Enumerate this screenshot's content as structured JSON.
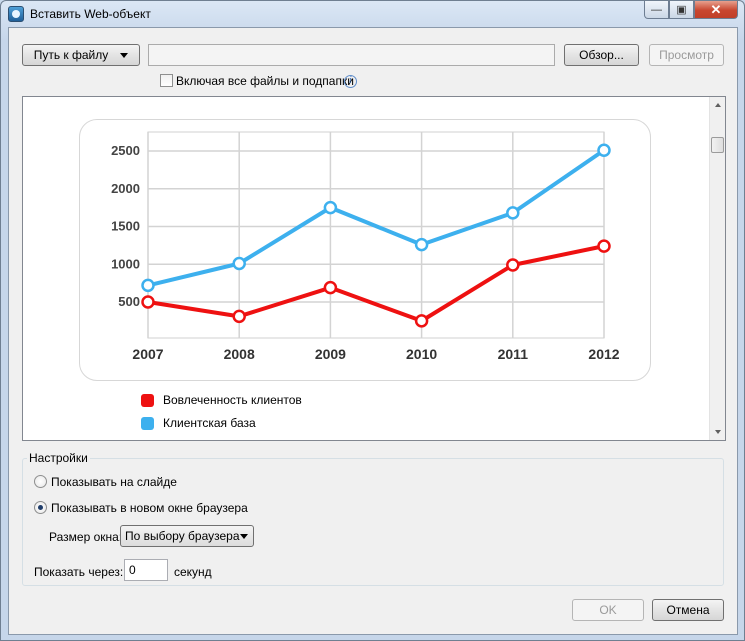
{
  "window": {
    "title": "Вставить Web-объект"
  },
  "toolbar": {
    "path_button_label": "Путь к файлу",
    "path_value": "",
    "browse_label": "Обзор...",
    "preview_label": "Просмотр",
    "include_subfolders_label": "Включая все файлы и подпапки",
    "include_subfolders_checked": false
  },
  "chart_data": {
    "type": "line",
    "x": [
      "2007",
      "2008",
      "2009",
      "2010",
      "2011",
      "2012"
    ],
    "y_ticks": [
      "2500",
      "2000",
      "1500",
      "1000",
      "500"
    ],
    "ylim": [
      0,
      2500
    ],
    "grid": true,
    "series": [
      {
        "name": "Вовлеченность клиентов",
        "color": "#ee1111",
        "values": [
          500,
          310,
          690,
          250,
          990,
          1240
        ]
      },
      {
        "name": "Клиентская база",
        "color": "#3db0ee",
        "values": [
          720,
          1010,
          1750,
          1260,
          1680,
          2510
        ]
      }
    ],
    "legend_position": "bottom-left"
  },
  "settings": {
    "group_title": "Настройки",
    "show_on_slide_label": "Показывать на слайде",
    "show_in_browser_label": "Показывать в новом окне браузера",
    "selected_option": "browser",
    "window_size_label": "Размер окна:",
    "window_size_value": "По выбору браузера",
    "show_after_label": "Показать через:",
    "show_after_value": "0",
    "seconds_label": "секунд"
  },
  "footer": {
    "ok_label": "OK",
    "cancel_label": "Отмена"
  }
}
